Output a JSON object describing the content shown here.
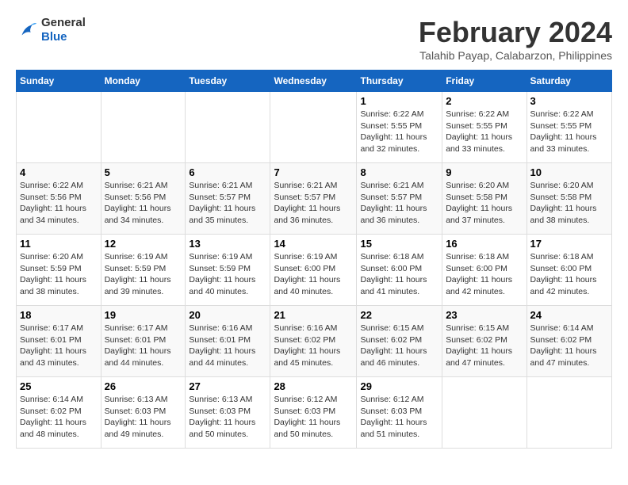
{
  "header": {
    "logo_general": "General",
    "logo_blue": "Blue",
    "title": "February 2024",
    "subtitle": "Talahib Payap, Calabarzon, Philippines"
  },
  "calendar": {
    "days_of_week": [
      "Sunday",
      "Monday",
      "Tuesday",
      "Wednesday",
      "Thursday",
      "Friday",
      "Saturday"
    ],
    "weeks": [
      [
        {
          "day": "",
          "info": ""
        },
        {
          "day": "",
          "info": ""
        },
        {
          "day": "",
          "info": ""
        },
        {
          "day": "",
          "info": ""
        },
        {
          "day": "1",
          "info": "Sunrise: 6:22 AM\nSunset: 5:55 PM\nDaylight: 11 hours and 32 minutes."
        },
        {
          "day": "2",
          "info": "Sunrise: 6:22 AM\nSunset: 5:55 PM\nDaylight: 11 hours and 33 minutes."
        },
        {
          "day": "3",
          "info": "Sunrise: 6:22 AM\nSunset: 5:55 PM\nDaylight: 11 hours and 33 minutes."
        }
      ],
      [
        {
          "day": "4",
          "info": "Sunrise: 6:22 AM\nSunset: 5:56 PM\nDaylight: 11 hours and 34 minutes."
        },
        {
          "day": "5",
          "info": "Sunrise: 6:21 AM\nSunset: 5:56 PM\nDaylight: 11 hours and 34 minutes."
        },
        {
          "day": "6",
          "info": "Sunrise: 6:21 AM\nSunset: 5:57 PM\nDaylight: 11 hours and 35 minutes."
        },
        {
          "day": "7",
          "info": "Sunrise: 6:21 AM\nSunset: 5:57 PM\nDaylight: 11 hours and 36 minutes."
        },
        {
          "day": "8",
          "info": "Sunrise: 6:21 AM\nSunset: 5:57 PM\nDaylight: 11 hours and 36 minutes."
        },
        {
          "day": "9",
          "info": "Sunrise: 6:20 AM\nSunset: 5:58 PM\nDaylight: 11 hours and 37 minutes."
        },
        {
          "day": "10",
          "info": "Sunrise: 6:20 AM\nSunset: 5:58 PM\nDaylight: 11 hours and 38 minutes."
        }
      ],
      [
        {
          "day": "11",
          "info": "Sunrise: 6:20 AM\nSunset: 5:59 PM\nDaylight: 11 hours and 38 minutes."
        },
        {
          "day": "12",
          "info": "Sunrise: 6:19 AM\nSunset: 5:59 PM\nDaylight: 11 hours and 39 minutes."
        },
        {
          "day": "13",
          "info": "Sunrise: 6:19 AM\nSunset: 5:59 PM\nDaylight: 11 hours and 40 minutes."
        },
        {
          "day": "14",
          "info": "Sunrise: 6:19 AM\nSunset: 6:00 PM\nDaylight: 11 hours and 40 minutes."
        },
        {
          "day": "15",
          "info": "Sunrise: 6:18 AM\nSunset: 6:00 PM\nDaylight: 11 hours and 41 minutes."
        },
        {
          "day": "16",
          "info": "Sunrise: 6:18 AM\nSunset: 6:00 PM\nDaylight: 11 hours and 42 minutes."
        },
        {
          "day": "17",
          "info": "Sunrise: 6:18 AM\nSunset: 6:00 PM\nDaylight: 11 hours and 42 minutes."
        }
      ],
      [
        {
          "day": "18",
          "info": "Sunrise: 6:17 AM\nSunset: 6:01 PM\nDaylight: 11 hours and 43 minutes."
        },
        {
          "day": "19",
          "info": "Sunrise: 6:17 AM\nSunset: 6:01 PM\nDaylight: 11 hours and 44 minutes."
        },
        {
          "day": "20",
          "info": "Sunrise: 6:16 AM\nSunset: 6:01 PM\nDaylight: 11 hours and 44 minutes."
        },
        {
          "day": "21",
          "info": "Sunrise: 6:16 AM\nSunset: 6:02 PM\nDaylight: 11 hours and 45 minutes."
        },
        {
          "day": "22",
          "info": "Sunrise: 6:15 AM\nSunset: 6:02 PM\nDaylight: 11 hours and 46 minutes."
        },
        {
          "day": "23",
          "info": "Sunrise: 6:15 AM\nSunset: 6:02 PM\nDaylight: 11 hours and 47 minutes."
        },
        {
          "day": "24",
          "info": "Sunrise: 6:14 AM\nSunset: 6:02 PM\nDaylight: 11 hours and 47 minutes."
        }
      ],
      [
        {
          "day": "25",
          "info": "Sunrise: 6:14 AM\nSunset: 6:02 PM\nDaylight: 11 hours and 48 minutes."
        },
        {
          "day": "26",
          "info": "Sunrise: 6:13 AM\nSunset: 6:03 PM\nDaylight: 11 hours and 49 minutes."
        },
        {
          "day": "27",
          "info": "Sunrise: 6:13 AM\nSunset: 6:03 PM\nDaylight: 11 hours and 50 minutes."
        },
        {
          "day": "28",
          "info": "Sunrise: 6:12 AM\nSunset: 6:03 PM\nDaylight: 11 hours and 50 minutes."
        },
        {
          "day": "29",
          "info": "Sunrise: 6:12 AM\nSunset: 6:03 PM\nDaylight: 11 hours and 51 minutes."
        },
        {
          "day": "",
          "info": ""
        },
        {
          "day": "",
          "info": ""
        }
      ]
    ]
  }
}
